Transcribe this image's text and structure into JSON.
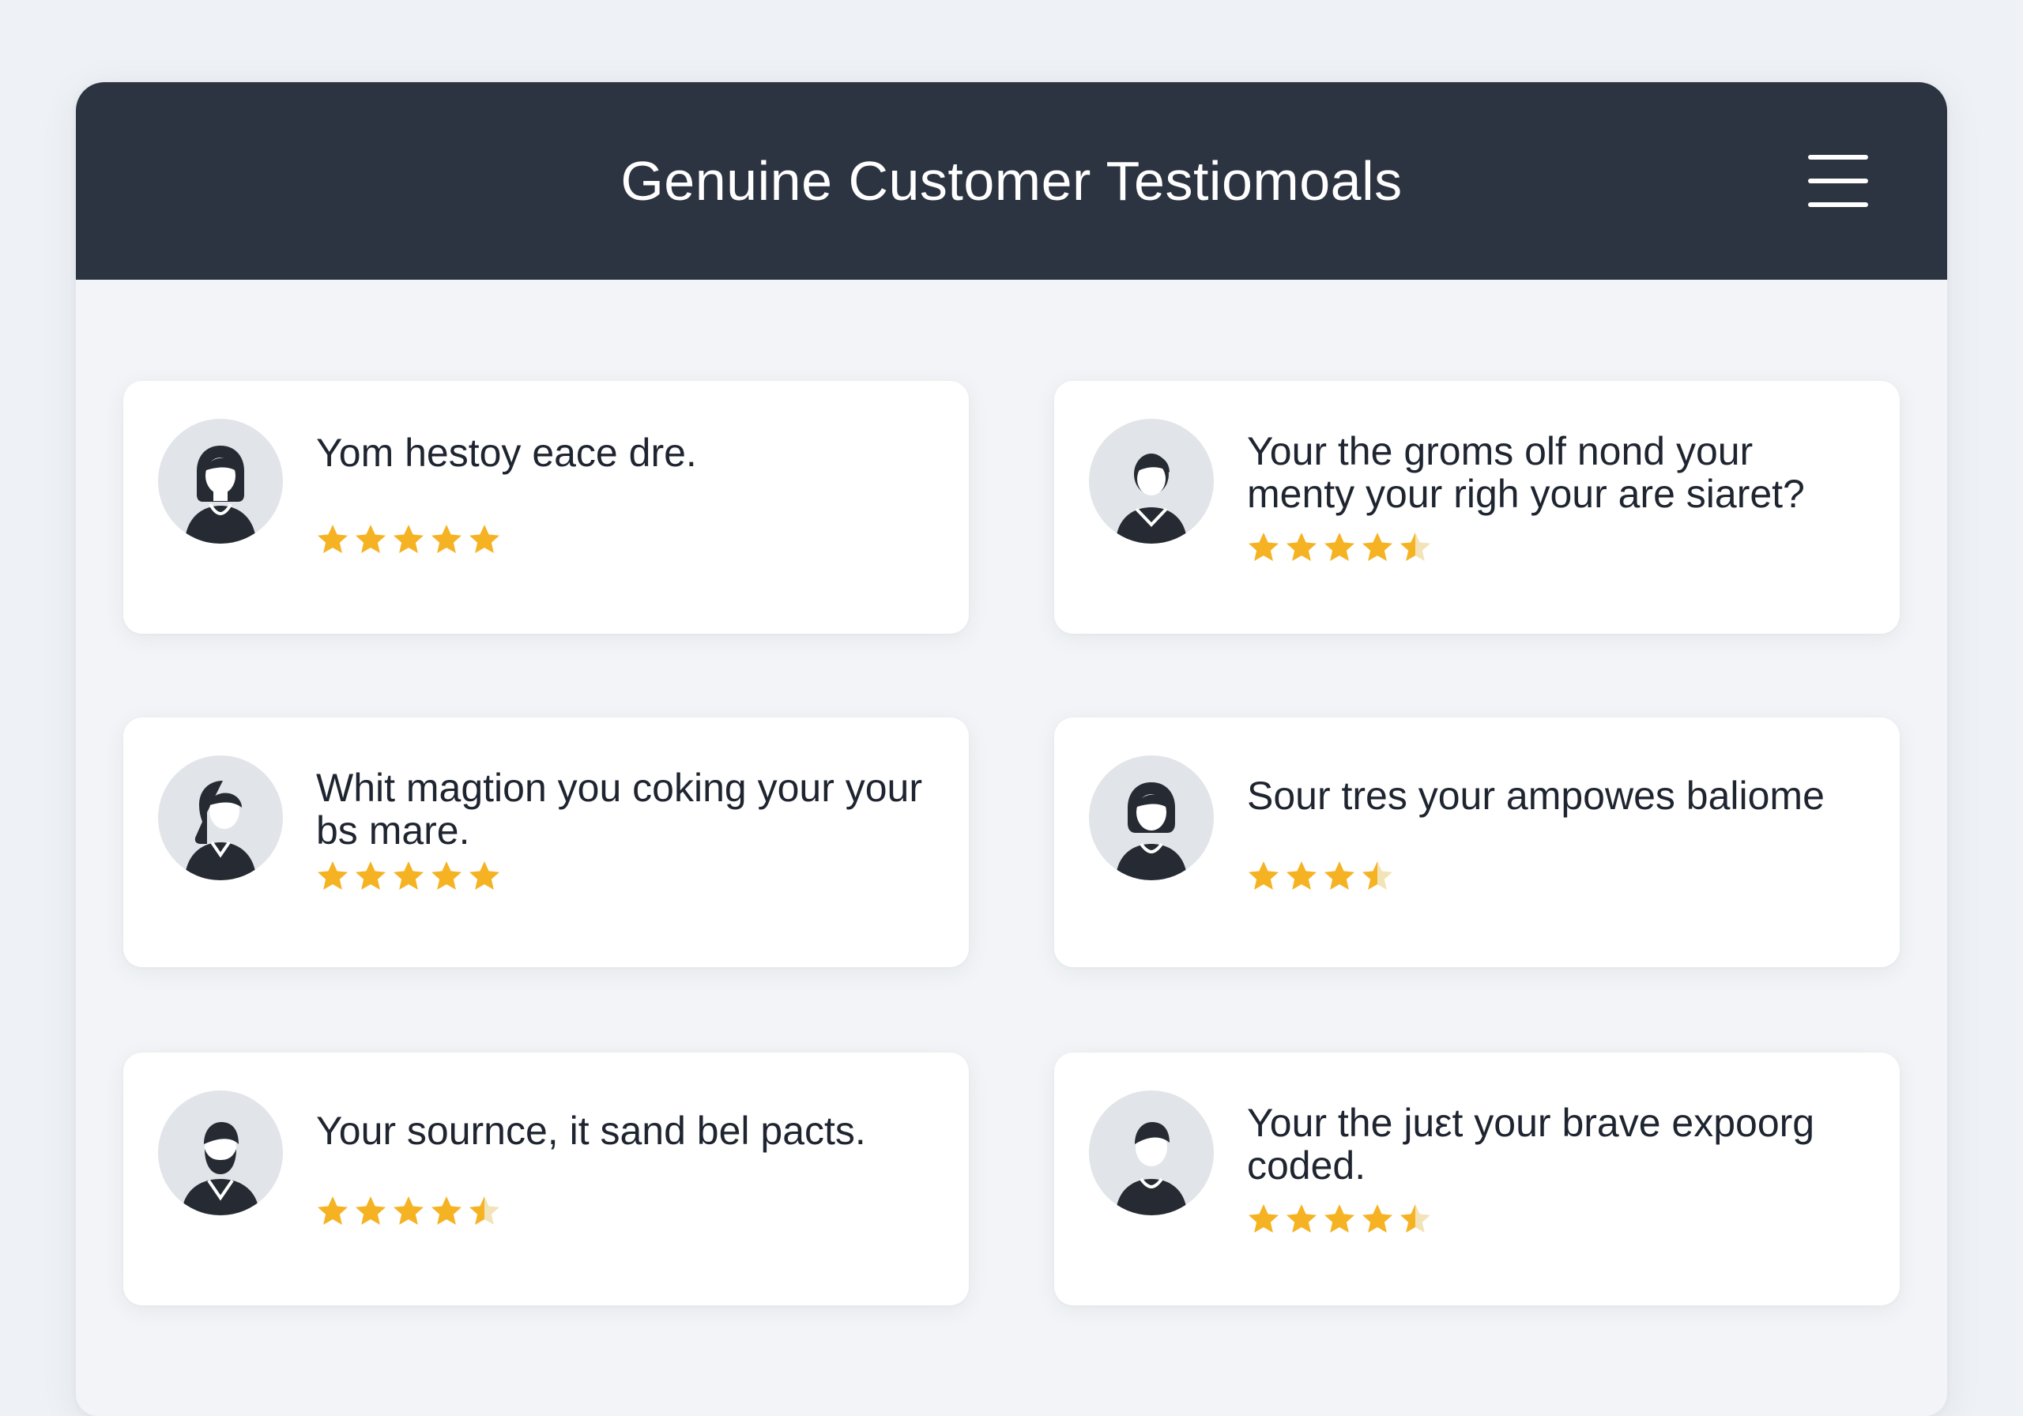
{
  "header": {
    "title": "Genuine Customer Testiomoals",
    "menu_icon": "hamburger-menu-icon",
    "background": "#2d3441"
  },
  "accent": {
    "star_color": "#f5b324",
    "star_empty": "#f3e3b8"
  },
  "testimonials": [
    {
      "quote": "Yom hestoy eace dre.",
      "rating": 5,
      "avatar": "woman-avatar-icon"
    },
    {
      "quote": "Your the groms olf nond your menty your righ your are siaret?",
      "rating": 4.5,
      "avatar": "man-avatar-icon"
    },
    {
      "quote": "Whit magtion you coking your your bs mare.",
      "rating": 5,
      "avatar": "woman-ponytail-avatar-icon"
    },
    {
      "quote": "Sour tres your ampowes baliome",
      "rating": 3.5,
      "avatar": "woman-avatar-icon"
    },
    {
      "quote": "Your sournce, it sand bel pacts.",
      "rating": 4.5,
      "avatar": "bearded-man-avatar-icon"
    },
    {
      "quote": "Your the juεt your brave expoorg coded.",
      "rating": 4.5,
      "avatar": "man-avatar-icon"
    }
  ]
}
